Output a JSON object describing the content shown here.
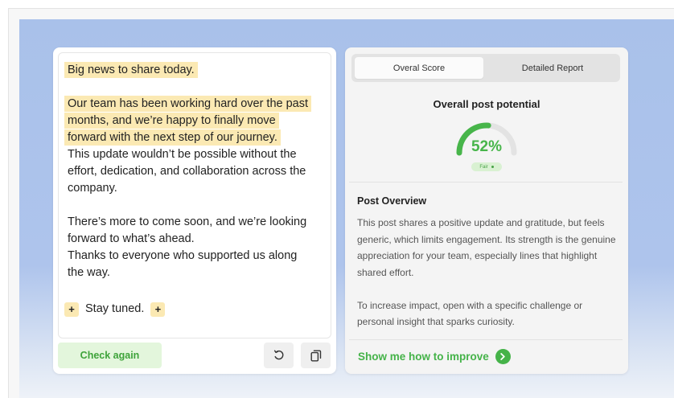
{
  "editor": {
    "lines_group1": [
      "Big news to share today."
    ],
    "lines_group2_highlighted": [
      "Our team has been working hard over the past",
      "months, and we’re happy to finally move",
      "forward with the next step of our journey."
    ],
    "lines_group2_plain": [
      "This update wouldn’t be possible without the",
      "effort, dedication, and collaboration across the",
      "company."
    ],
    "lines_group3": [
      "There’s more to come soon, and we’re looking",
      "forward to what’s ahead.",
      "Thanks to everyone who supported us along",
      "the way."
    ],
    "plus_label": "+",
    "closing": "Stay tuned."
  },
  "actions": {
    "check_again": "Check again",
    "undo_icon": "undo-icon",
    "copy_icon": "copy-icon"
  },
  "score": {
    "tabs": [
      "Overal Score",
      "Detailed Report"
    ],
    "active_tab": 0,
    "title": "Overall post potential",
    "percent": 52,
    "value_label": "52%",
    "rating": "Fair",
    "gauge_color": "#47b54a",
    "gauge_track": "#e3e3e3"
  },
  "overview": {
    "title": "Post Overview",
    "paragraphs": [
      "This post shares a positive update and gratitude, but feels generic, which limits engagement. Its strength is the genuine appreciation for your team, especially lines that highlight shared effort.",
      "To increase impact, open with a specific challenge or personal insight that sparks curiosity."
    ]
  },
  "improve": {
    "label": "Show me how to improve",
    "icon": "chevron-right-icon"
  },
  "colors": {
    "highlight": "#fbe9b3",
    "accent_green": "#45b349",
    "backdrop_blue": "#a9c1ea"
  }
}
